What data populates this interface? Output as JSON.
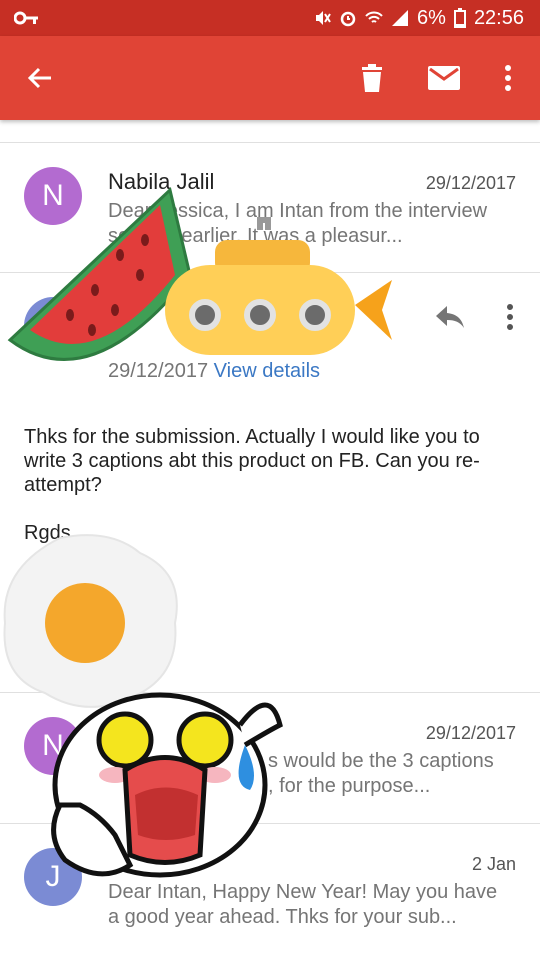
{
  "status": {
    "battery": "6%",
    "time": "22:56"
  },
  "toolbar": {
    "back": "back-arrow",
    "delete": "trash-icon",
    "mark": "mail-icon",
    "more": "more-icon"
  },
  "emails": [
    {
      "initial": "N",
      "sender": "Nabila Jalil",
      "date": "29/12/2017",
      "snippet_1": "Dear Jessica, I am Intan from the interview",
      "snippet_2": "session earlier. It was a pleasur..."
    },
    {
      "initial": "N",
      "date": "29/12/2017",
      "snippet_1": "s would be the 3 captions",
      "snippet_2": ", for the purpose..."
    },
    {
      "initial": "J",
      "date": "2 Jan",
      "snippet_1": "Dear Intan, Happy New Year! May you have",
      "snippet_2": "a good year ahead. Thks for your sub..."
    }
  ],
  "open_message": {
    "date": "29/12/2017",
    "details_link": "View details",
    "body_1": "Thks for the submission. Actually I would like you to",
    "body_2": "write 3 captions abt this product on FB. Can you re-",
    "body_3": "attempt?",
    "signoff": "Rgds"
  },
  "colors": {
    "statusbar": "#c62f24",
    "toolbar": "#e04436",
    "avatar_n": "#b36bd0",
    "avatar_j": "#7b8bd4",
    "link": "#3b78c4"
  }
}
